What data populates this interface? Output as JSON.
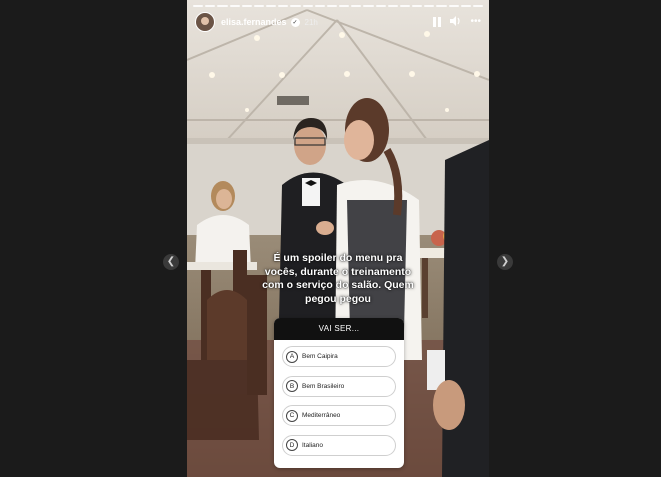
{
  "story": {
    "username": "elisa.fernandes",
    "time": "21h",
    "caption_lines": [
      "É um spoiler do menu pra",
      "vocês, durante  o treinamento",
      "com o serviço do salão. Quem",
      "pegou pegou"
    ],
    "icons": {
      "pause": "pause-icon",
      "volume": "volume-icon",
      "more": "more-icon",
      "verified": "verified-icon",
      "prev": "chevron-left-icon",
      "next": "chevron-right-icon"
    }
  },
  "quiz": {
    "question": "VAI SER...",
    "options": [
      {
        "letter": "A",
        "text": "Bem Caipira"
      },
      {
        "letter": "B",
        "text": "Bem Brasileiro"
      },
      {
        "letter": "C",
        "text": "Mediterrâneo"
      },
      {
        "letter": "D",
        "text": "Italiano"
      }
    ]
  }
}
